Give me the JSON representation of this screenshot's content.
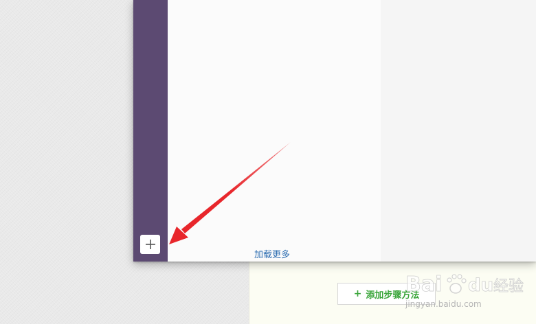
{
  "app": {
    "rail_add_label": "+",
    "load_more": "加载更多"
  },
  "page": {
    "add_step_plus": "+",
    "add_step_label": "添加步骤方法"
  },
  "annotation": {
    "arrow_color": "#e8262b"
  },
  "watermark": {
    "brand": "Baidu经验",
    "url": "jingyan.baidu.com"
  },
  "colors": {
    "rail": "#5c4a72",
    "link": "#2b6cb0",
    "accent_green": "#3aa53a"
  }
}
